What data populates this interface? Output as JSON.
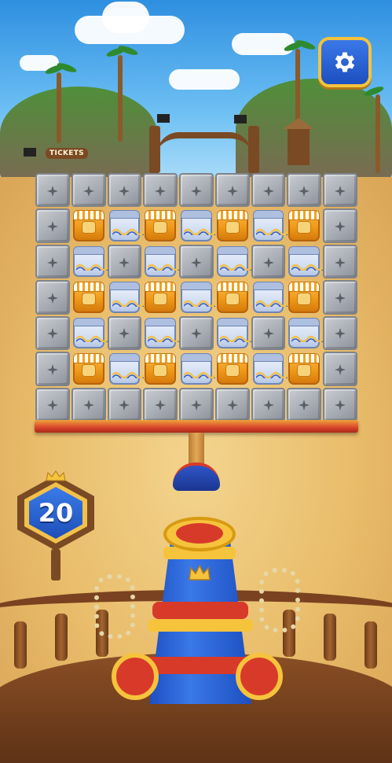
{
  "hud": {
    "moves_left": "20",
    "settings_icon": "gear-icon"
  },
  "scenery": {
    "tickets_sign": "TICKETS"
  },
  "board": {
    "rows": 7,
    "cols": 9,
    "cells": [
      [
        "stone",
        "stone",
        "stone",
        "stone",
        "stone",
        "stone",
        "stone",
        "stone",
        "stone"
      ],
      [
        "stone",
        "honey",
        "empty",
        "honey",
        "empty",
        "honey",
        "empty",
        "honey",
        "stone"
      ],
      [
        "stone",
        "empty",
        "stone",
        "empty",
        "stone",
        "empty",
        "stone",
        "empty",
        "stone"
      ],
      [
        "stone",
        "honey",
        "empty",
        "honey",
        "empty",
        "honey",
        "empty",
        "honey",
        "stone"
      ],
      [
        "stone",
        "empty",
        "stone",
        "empty",
        "stone",
        "empty",
        "stone",
        "empty",
        "stone"
      ],
      [
        "stone",
        "honey",
        "empty",
        "honey",
        "empty",
        "honey",
        "empty",
        "honey",
        "stone"
      ],
      [
        "stone",
        "stone",
        "stone",
        "stone",
        "stone",
        "stone",
        "stone",
        "stone",
        "stone"
      ]
    ]
  },
  "colors": {
    "accent_blue": "#1d4fc0",
    "accent_gold": "#f6c33c",
    "accent_red": "#d83a2a",
    "honey": "#ef9a1a",
    "stone": "#a6aab2"
  }
}
